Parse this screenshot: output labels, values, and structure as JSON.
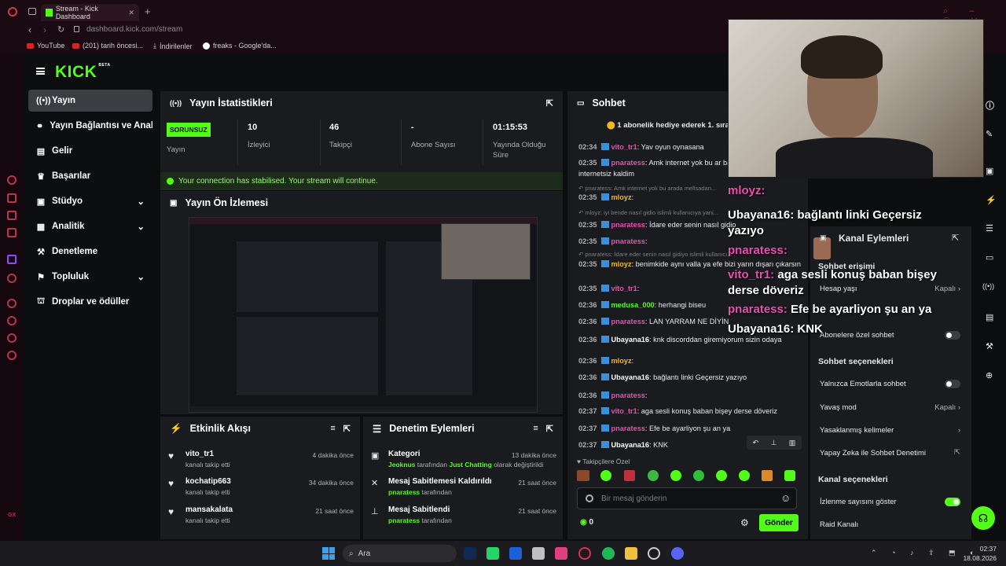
{
  "browser": {
    "tab_title": "Stream - Kick Dashboard",
    "url_host": "dashboard.kick.com",
    "url_path": "/stream",
    "bookmarks": [
      "YouTube",
      "(201) tarih öncesi...",
      "İndirilenler",
      "freaks - Google'da..."
    ]
  },
  "header": {
    "logo": "KICK",
    "beta": "BETA"
  },
  "sidebar": {
    "items": [
      {
        "label": "Yayın",
        "icon": "broadcast-icon"
      },
      {
        "label": "Yayın Bağlantısı ve Anahtarı",
        "icon": "link-icon"
      },
      {
        "label": "Gelir",
        "icon": "money-icon"
      },
      {
        "label": "Başarılar",
        "icon": "trophy-icon"
      },
      {
        "label": "Stüdyo",
        "icon": "studio-icon"
      },
      {
        "label": "Analitik",
        "icon": "chart-icon"
      },
      {
        "label": "Denetleme",
        "icon": "moderation-icon"
      },
      {
        "label": "Topluluk",
        "icon": "community-icon"
      },
      {
        "label": "Droplar ve ödüller",
        "icon": "gift-icon"
      }
    ]
  },
  "stats": {
    "title": "Yayın İstatistikleri",
    "badge": "SORUNSUZ",
    "items": [
      {
        "label": "Yayın",
        "value": ""
      },
      {
        "value": "10",
        "label": "İzleyici"
      },
      {
        "value": "46",
        "label": "Takipçi"
      },
      {
        "value": "-",
        "label": "Abone Sayısı"
      },
      {
        "value": "01:15:53",
        "label": "Yayında Olduğu Süre"
      }
    ],
    "notice": "Your connection has stabilised. Your stream will continue."
  },
  "preview": {
    "title": "Yayın Ön İzlemesi"
  },
  "activity": {
    "title": "Etkinlik Akışı",
    "items": [
      {
        "name": "vito_tr1",
        "desc": "kanalı takip etti",
        "time": "4 dakika önce"
      },
      {
        "name": "kochatip663",
        "desc": "kanalı takip etti",
        "time": "34 dakika önce"
      },
      {
        "name": "mansakalata",
        "desc": "kanalı takip etti",
        "time": "21 saat önce"
      }
    ]
  },
  "modlog": {
    "title": "Denetim Eylemleri",
    "items": [
      {
        "name": "Kategori",
        "desc_user": "Jeoknus",
        "desc_mid": " tarafından ",
        "desc_hl": "Just Chatting",
        "desc_end": " olarak değiştirildi",
        "time": "13 dakika önce"
      },
      {
        "name": "Mesaj Sabitlemesi Kaldırıldı",
        "desc_user": "pnaratess",
        "desc_end": " tarafından",
        "time": "21 saat önce"
      },
      {
        "name": "Mesaj Sabitlendi",
        "desc_user": "pnaratess",
        "desc_end": " tarafından",
        "time": "21 saat önce"
      }
    ]
  },
  "chat": {
    "title": "Sohbet",
    "pinned": "1 abonelik hediye ederek 1. sıra",
    "messages": [
      {
        "time": "02:34",
        "user": "vito_tr1",
        "color": "#e84fb0",
        "text": "Yav oyun oynasana"
      },
      {
        "time": "02:35",
        "user": "pnaratess",
        "color": "#e84fb0",
        "text": "Amk internet yok bu ar bağlanıyorum fuck farit internetsiz kaldim"
      },
      {
        "reply": "pnaratess: Amk internet yok bu arada mellsadan..."
      },
      {
        "time": "02:35",
        "user": "mloyz",
        "color": "#f5b71b",
        "text": ""
      },
      {
        "reply": "mloyz: iyi bende nasıl gidio islimli kullanıcıya yani..."
      },
      {
        "time": "02:35",
        "user": "pnaratess",
        "color": "#e84fb0",
        "text": "İdare eder senin nasıl gidio"
      },
      {
        "time": "02:35",
        "user": "pnaratess",
        "color": "#e84fb0",
        "text": ""
      },
      {
        "reply": "pnaratess: İdare eder senin nasıl gidiyo islimli kullanıcı..."
      },
      {
        "time": "02:35",
        "user": "mloyz",
        "color": "#f5b71b",
        "text": "benimkide aynı valla ya efe bizi yarın dışarı çıkarsın"
      },
      {
        "time": "02:35",
        "user": "vito_tr1",
        "color": "#e84fb0",
        "text": ""
      },
      {
        "time": "02:36",
        "user": "medusa_000",
        "color": "#53fc18",
        "text": "herhangi biseu"
      },
      {
        "time": "02:36",
        "user": "pnaratess",
        "color": "#e84fb0",
        "text": "LAN YARRAM NE DİYİN"
      },
      {
        "time": "02:36",
        "user": "Ubayana16",
        "color": "#ffffff",
        "text": "knk discorddan giremiyorum sizin odaya"
      },
      {
        "time": "02:36",
        "user": "mloyz",
        "color": "#f5b71b",
        "text": ""
      },
      {
        "time": "02:36",
        "user": "Ubayana16",
        "color": "#ffffff",
        "text": "bağlantı linki Geçersiz yazıyo"
      },
      {
        "time": "02:36",
        "user": "pnaratess",
        "color": "#e84fb0",
        "text": ""
      },
      {
        "time": "02:37",
        "user": "vito_tr1",
        "color": "#e84fb0",
        "text": "aga sesli konuş baban bişey derse döveriz"
      },
      {
        "time": "02:37",
        "user": "pnaratess",
        "color": "#e84fb0",
        "text": "Efe be ayarliyon şu an ya"
      },
      {
        "time": "02:37",
        "user": "Ubayana16",
        "color": "#ffffff",
        "text": "KNK"
      }
    ],
    "followers_label": "Takipçilere Özel",
    "input_placeholder": "Bir mesaj gönderin",
    "points": "0",
    "send_label": "Gönder"
  },
  "overlay": {
    "lines": [
      {
        "user": "mloyz:",
        "color": "#e84fb0",
        "text": ""
      },
      {
        "user": "Ubayana16:",
        "color": "#ffffff",
        "text": "bağlantı linki Geçersiz yazıyo"
      },
      {
        "user": "pnaratess:",
        "color": "#e84fb0",
        "text": ""
      },
      {
        "user": "vito_tr1:",
        "color": "#e84fb0",
        "text": "aga sesli konuş baban bişey derse döveriz"
      },
      {
        "user": "pnaratess:",
        "color": "#e84fb0",
        "text": "Efe be ayarliyon şu an ya"
      },
      {
        "user": "Ubayana16:",
        "color": "#ffffff",
        "text": "KNK"
      }
    ]
  },
  "channel_actions": {
    "title": "Kanal Eylemleri",
    "sub": "Sohbet erişimi",
    "rows": [
      {
        "label": "Hesap yaşı",
        "value": "Kapalı"
      },
      {
        "label": "Abonelere özel sohbet",
        "value": ""
      }
    ],
    "section2": "Sohbet seçenekleri",
    "rows2": [
      {
        "label": "Yalnızca Emotlarla sohbet",
        "value": ""
      },
      {
        "label": "Yavaş mod",
        "value": "Kapalı"
      },
      {
        "label": "Yasaklanmış kelimeler",
        "value": ""
      },
      {
        "label": "Yapay Zeka ile Sohbet Denetimi",
        "value": ""
      }
    ],
    "section3": "Kanal seçenekleri",
    "rows3": [
      {
        "label": "İzlenme sayısını göster",
        "value": ""
      },
      {
        "label": "Raid Kanalı",
        "value": ""
      }
    ]
  },
  "taskbar": {
    "search": "Ara",
    "time": "02:37",
    "date": "18.08.2026"
  }
}
